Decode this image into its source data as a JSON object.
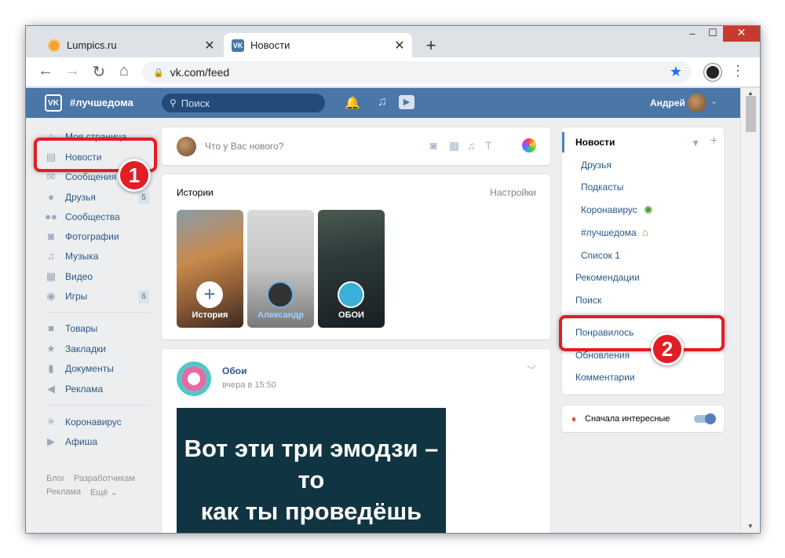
{
  "browser": {
    "tabs": [
      {
        "title": "Lumpics.ru",
        "close": "✕"
      },
      {
        "title": "Новости",
        "close": "✕"
      }
    ],
    "new_tab": "+",
    "url": "vk.com/feed"
  },
  "vk": {
    "logo": "VK",
    "hashtag": "#лучшедома",
    "search_placeholder": "Поиск",
    "user": "Андрей",
    "left_nav": [
      {
        "label": "Моя страница",
        "icon": "home-icon"
      },
      {
        "label": "Новости",
        "icon": "news-icon"
      },
      {
        "label": "Сообщения",
        "icon": "messages-icon"
      },
      {
        "label": "Друзья",
        "icon": "friends-icon",
        "badge": "5"
      },
      {
        "label": "Сообщества",
        "icon": "communities-icon"
      },
      {
        "label": "Фотографии",
        "icon": "photos-icon"
      },
      {
        "label": "Музыка",
        "icon": "music-icon"
      },
      {
        "label": "Видео",
        "icon": "video-icon"
      },
      {
        "label": "Игры",
        "icon": "games-icon",
        "badge": "6"
      },
      {
        "label": "Товары",
        "icon": "goods-icon"
      },
      {
        "label": "Закладки",
        "icon": "bookmarks-icon"
      },
      {
        "label": "Документы",
        "icon": "documents-icon"
      },
      {
        "label": "Реклама",
        "icon": "ads-icon"
      },
      {
        "label": "Коронавирус",
        "icon": "coronavirus-icon"
      },
      {
        "label": "Афиша",
        "icon": "afisha-icon"
      }
    ],
    "footer": {
      "blog": "Блог",
      "dev": "Разработчикам",
      "ads": "Реклама",
      "more": "Ещё ⌄"
    },
    "compose_placeholder": "Что у Вас нового?",
    "stories": {
      "title": "Истории",
      "settings": "Настройки",
      "items": [
        "История",
        "Александр",
        "ОБОИ"
      ]
    },
    "post": {
      "author": "Обои",
      "time": "вчера в 15:50",
      "image_text_1": "Вот эти три эмодзи – то",
      "image_text_2": "как ты проведёшь лето"
    },
    "right_menu": {
      "news": "Новости",
      "subs": [
        "Друзья",
        "Подкасты",
        "Коронавирус",
        "#лучшедома",
        "Список 1"
      ],
      "items": [
        "Рекомендации",
        "Поиск",
        "Понравилось",
        "Обновления",
        "Комментарии"
      ]
    },
    "interest": "Сначала интересные"
  },
  "annotations": {
    "one": "1",
    "two": "2"
  },
  "colors": {
    "vk_blue": "#4a76a8",
    "link": "#2a5885",
    "marker_red": "#e21d23"
  }
}
